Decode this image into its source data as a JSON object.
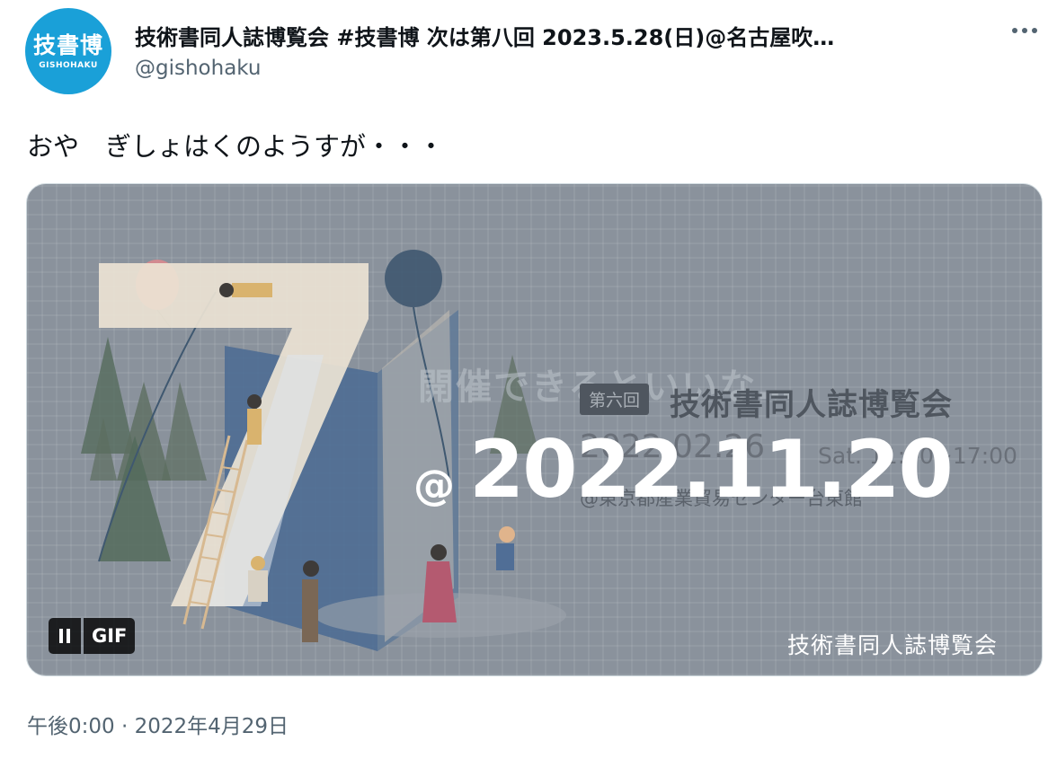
{
  "author": {
    "avatar_kanji": "技書博",
    "avatar_roman": "GISHOHAKU",
    "display_name": "技術書同人誌博覧会 #技書博 次は第八回 2023.5.28(日)@名古屋吹…",
    "handle": "@gishohaku",
    "avatar_color": "#1aa0d8"
  },
  "tweet": {
    "text": "おや　ぎしょはくのようすが・・・",
    "timestamp": "午後0:00 · 2022年4月29日"
  },
  "media": {
    "wish_text": "開催できるといいな…",
    "edition_badge": "第六回",
    "event_name": "技術書同人誌博覧会",
    "old_date": "2022.02.26",
    "old_time": "Sat. 11:00~17:00",
    "old_venue": "@東京都産業貿易センター台東館",
    "at_mark": "@",
    "new_date": "2022.11.20",
    "big_numeral": "7",
    "watermark": "技術書同人誌博覧会",
    "gif_label": "GIF"
  }
}
